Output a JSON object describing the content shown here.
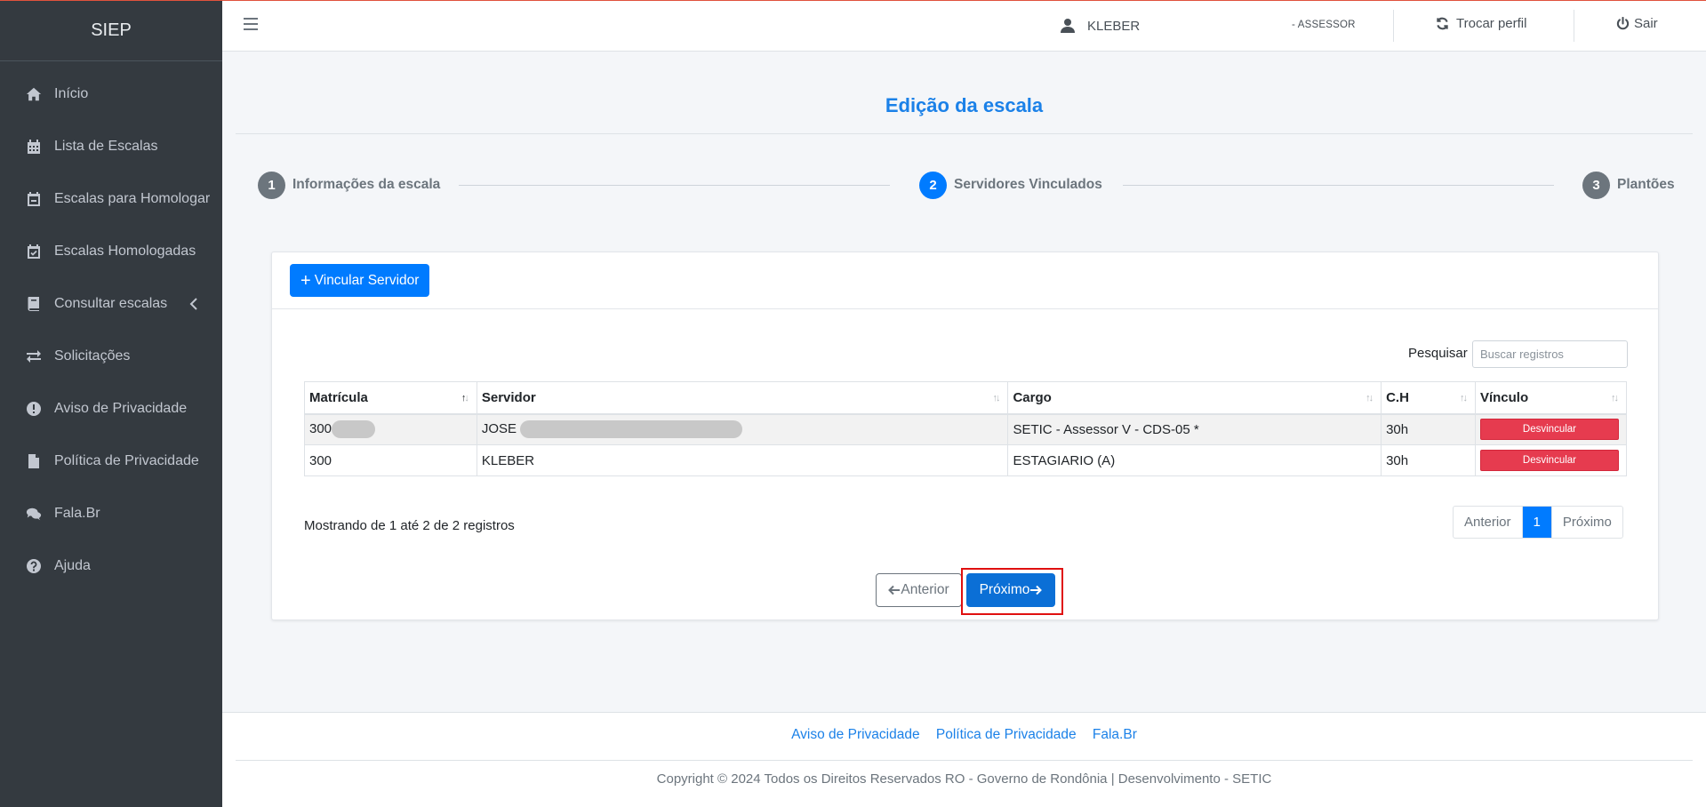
{
  "brand": "SIEP",
  "sidebar": {
    "items": [
      {
        "label": "Início",
        "icon": "home-icon"
      },
      {
        "label": "Lista de Escalas",
        "icon": "calendar-icon"
      },
      {
        "label": "Escalas para Homologar",
        "icon": "calendar-minus-icon"
      },
      {
        "label": "Escalas Homologadas",
        "icon": "calendar-check-icon"
      },
      {
        "label": "Consultar escalas",
        "icon": "book-icon"
      },
      {
        "label": "Solicitações",
        "icon": "exchange-icon"
      },
      {
        "label": "Aviso de Privacidade",
        "icon": "exclamation-circle-icon"
      },
      {
        "label": "Política de Privacidade",
        "icon": "file-icon"
      },
      {
        "label": "Fala.Br",
        "icon": "comments-icon"
      },
      {
        "label": "Ajuda",
        "icon": "question-circle-icon"
      }
    ]
  },
  "header": {
    "user": "KLEBER",
    "role": "- ASSESSOR",
    "switch_profile": "Trocar perfil",
    "logout": "Sair"
  },
  "page": {
    "title": "Edição da escala",
    "steps": [
      {
        "number": "1",
        "label": "Informações da escala",
        "active": false
      },
      {
        "number": "2",
        "label": "Servidores Vinculados",
        "active": true
      },
      {
        "number": "3",
        "label": "Plantões",
        "active": false
      }
    ]
  },
  "card": {
    "add_button": "Vincular Servidor",
    "search_label": "Pesquisar",
    "search_placeholder": "Buscar registros",
    "columns": [
      "Matrícula",
      "Servidor",
      "Cargo",
      "C.H",
      "Vínculo"
    ],
    "rows": [
      {
        "matricula": "300",
        "servidor": "JOSE",
        "cargo": "SETIC - Assessor V - CDS-05 *",
        "ch": "30h",
        "action": "Desvincular",
        "redacted": true
      },
      {
        "matricula": "300",
        "servidor": "KLEBER",
        "cargo": "ESTAGIARIO (A)",
        "ch": "30h",
        "action": "Desvincular",
        "redacted": false
      }
    ],
    "info": "Mostrando de 1 até 2 de 2 registros",
    "pagination": {
      "prev": "Anterior",
      "current": "1",
      "next": "Próximo"
    },
    "nav_prev": "Anterior",
    "nav_next": "Próximo"
  },
  "footer": {
    "links": [
      "Aviso de Privacidade",
      "Política de Privacidade",
      "Fala.Br"
    ],
    "copyright": "Copyright © 2024 Todos os Direitos Reservados RO - Governo de Rondônia | Desenvolvimento - SETIC"
  },
  "colors": {
    "sidebar_bg": "#343a40",
    "primary": "#007bff",
    "danger": "#e63b4f",
    "title": "#1b81e8"
  }
}
